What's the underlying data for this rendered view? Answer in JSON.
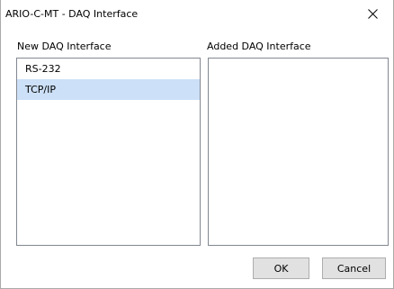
{
  "window": {
    "title": "ARIO-C-MT - DAQ Interface",
    "close_glyph": "close-icon"
  },
  "new_list": {
    "label": "New DAQ Interface",
    "items": [
      {
        "label": "RS-232",
        "selected": false
      },
      {
        "label": "TCP/IP",
        "selected": true
      }
    ]
  },
  "added_list": {
    "label": "Added DAQ Interface",
    "items": []
  },
  "buttons": {
    "ok_label": "OK",
    "cancel_label": "Cancel"
  },
  "colors": {
    "selection": "#cce0f7",
    "list_border": "#828790",
    "button_face": "#e1e1e1"
  }
}
